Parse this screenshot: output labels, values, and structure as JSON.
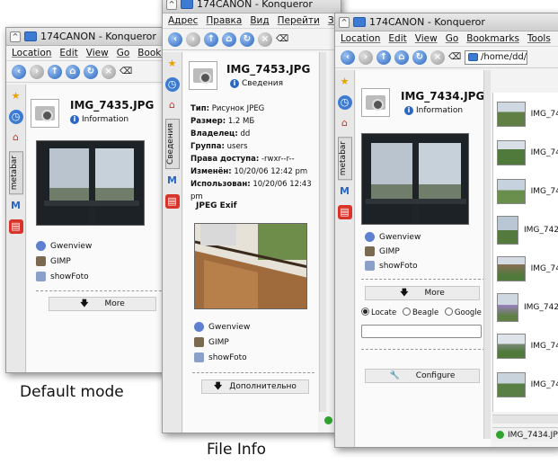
{
  "captions": {
    "default_mode": "Default mode",
    "file_info": "File Info"
  },
  "win1": {
    "title": "174CANON - Konqueror",
    "menu": [
      "Location",
      "Edit",
      "View",
      "Go",
      "Bookma"
    ],
    "sidebar_tab": "metabar",
    "file_name": "IMG_7435.JPG",
    "info_label": "Information",
    "apps": [
      "Gwenview",
      "GIMP",
      "showFoto"
    ],
    "more": "More"
  },
  "win2": {
    "title": "174CANON - Konqueror",
    "menu": [
      "Адрес",
      "Правка",
      "Вид",
      "Перейти",
      "Зак"
    ],
    "sidebar_tab": "Сведения",
    "file_name": "IMG_7453.JPG",
    "info_label": "Сведения",
    "meta": [
      {
        "k": "Тип:",
        "v": "Рисунок JPEG"
      },
      {
        "k": "Размер:",
        "v": "1.2 МБ"
      },
      {
        "k": "Владелец:",
        "v": "dd"
      },
      {
        "k": "Группа:",
        "v": "users"
      },
      {
        "k": "Права доступа:",
        "v": "-rwxr--r--"
      },
      {
        "k": "Изменён:",
        "v": "10/20/06 12:42 pm"
      },
      {
        "k": "Использован:",
        "v": "10/20/06 12:43 pm"
      }
    ],
    "exif_heading": "JPEG Exif",
    "apps": [
      "Gwenview",
      "GIMP",
      "showFoto"
    ],
    "more": "Дополнительно"
  },
  "win3": {
    "title": "174CANON - Konqueror",
    "menu": [
      "Location",
      "Edit",
      "View",
      "Go",
      "Bookmarks",
      "Tools",
      "Se"
    ],
    "url": "/home/dd/",
    "sidebar_tab": "metabar",
    "file_name": "IMG_7434.JPG",
    "info_label": "Information",
    "apps": [
      "Gwenview",
      "GIMP",
      "showFoto"
    ],
    "more": "More",
    "search": {
      "options": [
        "Locate",
        "Beagle",
        "Google"
      ],
      "selected": "Locate",
      "value": ""
    },
    "configure": "Configure",
    "files": [
      "IMG_74",
      "IMG_74",
      "IMG_74",
      "IMG_742",
      "IMG_74",
      "IMG_742",
      "IMG_74",
      "IMG_74"
    ],
    "status": "IMG_7434.JP"
  }
}
